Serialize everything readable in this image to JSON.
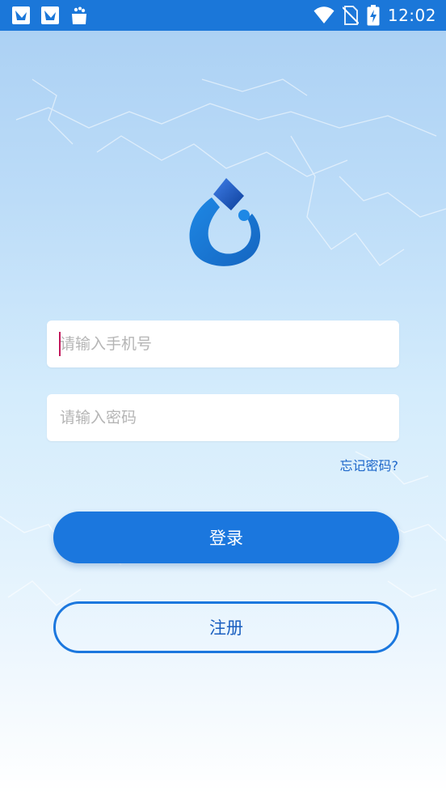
{
  "status_bar": {
    "time": "12:02",
    "notification_icons": [
      "app-notification-icon",
      "app-notification-icon",
      "bag-notification-icon"
    ],
    "right_icons": [
      "wifi-icon",
      "no-sim-icon",
      "battery-charging-icon"
    ]
  },
  "login": {
    "phone_placeholder": "请输入手机号",
    "password_placeholder": "请输入密码",
    "forgot_password": "忘记密码?",
    "login_button": "登录",
    "register_button": "注册"
  },
  "colors": {
    "status_bar": "#1b77d9",
    "primary": "#1b77de",
    "link": "#1e67c9"
  }
}
